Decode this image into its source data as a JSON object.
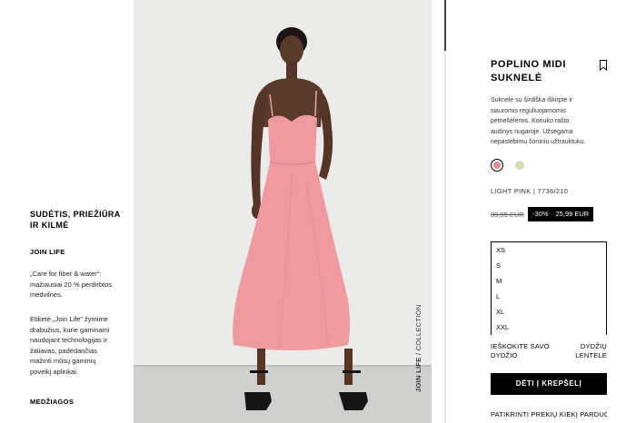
{
  "composition": {
    "title": "SUDĖTIS, PRIEŽIŪRA IR KILMĖ",
    "join_life_title": "JOIN LIFE",
    "para1": "„Care for fiber & water“: mažiausiai 20 % perdirbtos medvilnės.",
    "para2": "Etiketė „Join Life“ žymime drabužius, kurie gaminami naudojant technologijas ir žaliavas, padedančias mažinti mūsų gaminių poveikį aplinkai.",
    "materials_title": "MEDŽIAGOS"
  },
  "photo": {
    "vertical_label_bold": "JOIN LIFE",
    "vertical_label_rest": " / COLLECTION"
  },
  "product": {
    "title": "POPLINO MIDI SUKNELĖ",
    "description": "Suknelė su širdiška iškirpte ir siauromis reguliuojamomis petnešėlėmis. Koriuko rašto audinys nugaroje. Užsegama nepastebimu šoniniu užtrauktuku.",
    "color_line": "LIGHT PINK | 7736/210",
    "old_price": "39,95 EUR",
    "discount": "-30%",
    "new_price": "25,99 EUR",
    "swatch_colors": [
      "#e8888f",
      "#d8dcb0"
    ],
    "sizes": [
      "XS",
      "S",
      "M",
      "L",
      "XL",
      "XXL"
    ],
    "help_left": "IEŠKOKITE SAVO DYDŽIO",
    "help_right": "DYDŽIŲ LENTELĖ",
    "add_to_cart": "DĖTI Į KREPŠELĮ",
    "stock_link": "PATIKRINTI PREKIŲ KIEKĮ PARDUOTUVĖSE"
  }
}
